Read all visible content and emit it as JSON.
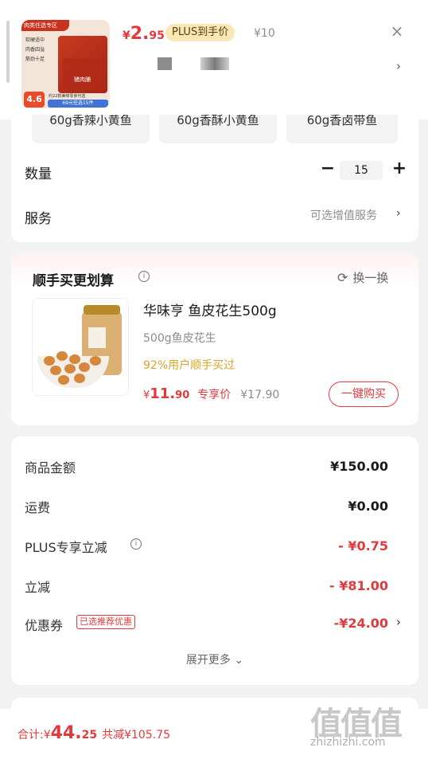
{
  "top_product": {
    "thumb_banner": "肉类任选专区",
    "thumb_checks": [
      "软硬适中",
      "肉香四溢",
      "筋劲十足"
    ],
    "thumb_rating": "4.6",
    "thumb_line": "约22款美味零食可选",
    "thumb_tag": "69元任选15件",
    "thumb_brand": "猪肉脯",
    "price_yen": "¥",
    "price_int": "2.",
    "price_dec": "95",
    "plus_tag": "PLUS到手价",
    "orig_price": "¥10",
    "close_icon": "×",
    "chevron": "›"
  },
  "specs": [
    "60g香辣小黄鱼",
    "60g香酥小黄鱼",
    "60g香卤带鱼"
  ],
  "quantity": {
    "label": "数量",
    "value": "15",
    "minus": "−",
    "plus": "+"
  },
  "service": {
    "label": "服务",
    "value": "可选增值服务",
    "chevron": "›"
  },
  "bundle": {
    "title": "顺手买更划算",
    "info": "i",
    "refresh_icon": "⟳",
    "refresh_label": "换一换",
    "name": "华味亨 鱼皮花生500g",
    "spec": "500g鱼皮花生",
    "stat": "92%用户顺手买过",
    "price_yen": "¥",
    "price_int": "11.",
    "price_dec": "90",
    "price_label": "专享价",
    "orig_price": "¥17.90",
    "buy_label": "一键购买"
  },
  "amounts": {
    "rows": [
      {
        "label": "商品金额",
        "value": "¥150.00"
      },
      {
        "label": "运费",
        "value": "¥0.00"
      },
      {
        "label": "PLUS专享立减",
        "value": "- ¥0.75"
      },
      {
        "label": "立减",
        "value": "- ¥81.00"
      },
      {
        "label": "优惠券",
        "value": "-¥24.00"
      }
    ],
    "info": "i",
    "coupon_tag": "已选推荐优惠",
    "coupon_chevron": "›",
    "expand": "展开更多 ⌄"
  },
  "footer": {
    "total_label": "合计: ",
    "total_yen": "¥",
    "total_int": "44.",
    "total_dec": "25",
    "saving": "共减¥105.75"
  },
  "watermark": {
    "big": "值值值",
    "small": "zhizhizhi.com"
  },
  "colors": {
    "accent": "#e4393c",
    "plus_bg": "#f9e7b5",
    "stat": "#d9a429"
  }
}
